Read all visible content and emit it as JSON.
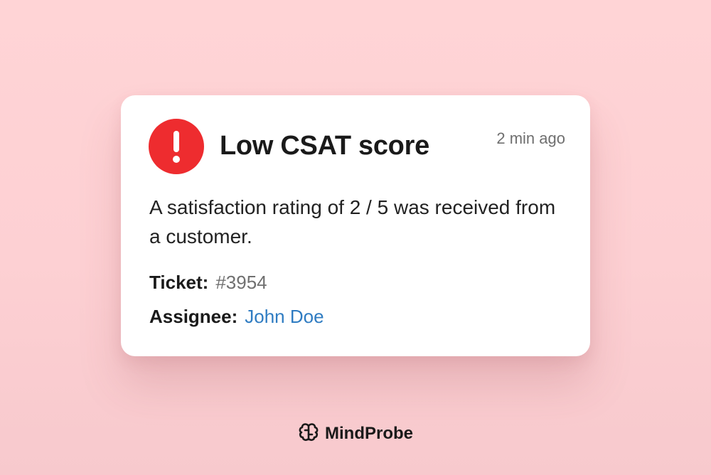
{
  "notification": {
    "icon": "alert-exclamation-icon",
    "icon_color": "#ee2c2f",
    "title": "Low CSAT score",
    "time": "2 min ago",
    "message": "A satisfaction rating of 2 / 5 was received from a customer.",
    "ticket_label": "Ticket:",
    "ticket_value": "#3954",
    "assignee_label": "Assignee:",
    "assignee_value": "John Doe",
    "link_color": "#2f7cc2"
  },
  "brand": {
    "icon": "brain-icon",
    "name": "MindProbe"
  }
}
